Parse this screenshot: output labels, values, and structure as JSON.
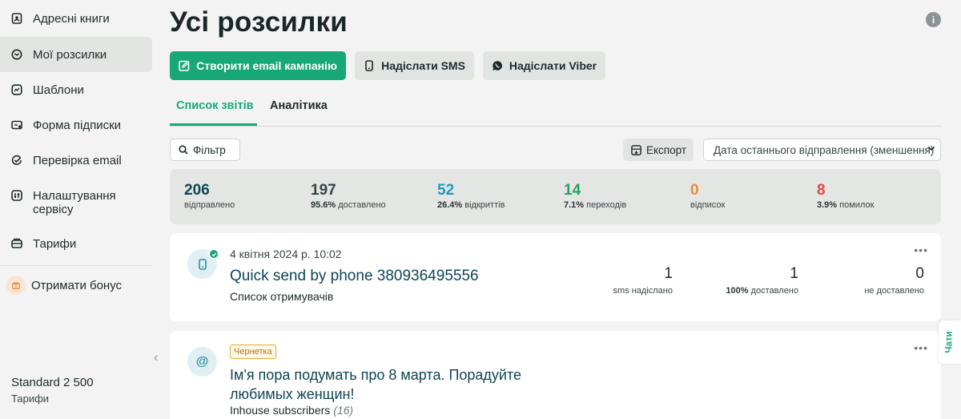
{
  "sidebar": {
    "items": [
      {
        "label": "Адресні книги",
        "icon": "address-book-icon",
        "active": false
      },
      {
        "label": "Мої розсилки",
        "icon": "campaigns-icon",
        "active": true
      },
      {
        "label": "Шаблони",
        "icon": "templates-icon",
        "active": false
      },
      {
        "label": "Форма підписки",
        "icon": "subscribe-form-icon",
        "active": false
      },
      {
        "label": "Перевірка email",
        "icon": "email-check-icon",
        "active": false
      },
      {
        "label": "Налаштування сервісу",
        "icon": "settings-icon",
        "active": false
      },
      {
        "label": "Тарифи",
        "icon": "tariffs-icon",
        "active": false
      }
    ],
    "bonus_label": "Отримати бонус",
    "plan_name": "Standard 2 500",
    "plan_link": "Тарифи"
  },
  "header": {
    "title": "Усі розсилки",
    "create_email_label": "Створити email кампанію",
    "send_sms_label": "Надіслати SMS",
    "send_viber_label": "Надіслати Viber"
  },
  "tabs": [
    {
      "label": "Список звітів",
      "active": true
    },
    {
      "label": "Аналітика",
      "active": false
    }
  ],
  "toolbar": {
    "filter_label": "Фільтр",
    "export_label": "Експорт",
    "sort_value": "Дата останнього відправлення (зменшення)"
  },
  "stats": [
    {
      "value": "206",
      "pct": "",
      "label": "відправлено",
      "color": "#0f4456"
    },
    {
      "value": "197",
      "pct": "95.6%",
      "label": "доставлено",
      "color": "#3a4444"
    },
    {
      "value": "52",
      "pct": "26.4%",
      "label": "відкриттів",
      "color": "#1d9bbf"
    },
    {
      "value": "14",
      "pct": "7.1%",
      "label": "переходів",
      "color": "#22a55a"
    },
    {
      "value": "0",
      "pct": "",
      "label": "відписок",
      "color": "#ef8a3c"
    },
    {
      "value": "8",
      "pct": "3.9%",
      "label": "помилок",
      "color": "#e5483f"
    }
  ],
  "campaigns": [
    {
      "date": "4 квітня 2024 р. 10:02",
      "title": "Quick send by phone 380936495556",
      "recipients": "Список отримувачів",
      "metrics": [
        {
          "value": "1",
          "pct": "",
          "label": "sms надіслано"
        },
        {
          "value": "1",
          "pct": "100%",
          "label": "доставлено"
        },
        {
          "value": "0",
          "pct": "",
          "label": "не доставлено"
        }
      ]
    },
    {
      "badge": "Чернетка",
      "title": "Ім'я пора подумать про 8 марта. Порадуйте любимых женщин!",
      "recipients": "Inhouse subscribers",
      "recipients_count": "(16)"
    }
  ],
  "chat_tab_label": "Чати",
  "colors": {
    "accent": "#18a878",
    "title_dark": "#0f4456",
    "draft": "#e6a92a"
  }
}
